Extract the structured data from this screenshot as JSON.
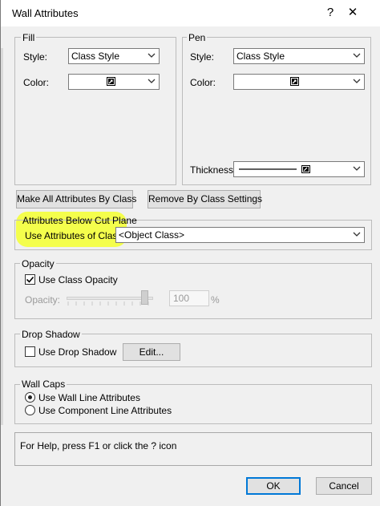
{
  "window": {
    "title": "Wall Attributes",
    "help_glyph": "?",
    "close_glyph": "✕"
  },
  "fill": {
    "group_label": "Fill",
    "style_label": "Style:",
    "style_value": "Class Style",
    "color_label": "Color:"
  },
  "pen": {
    "group_label": "Pen",
    "style_label": "Style:",
    "style_value": "Class Style",
    "color_label": "Color:",
    "thickness_label": "Thickness:"
  },
  "buttons": {
    "make_all": "Make All Attributes By Class",
    "remove_by_class": "Remove By Class Settings",
    "edit": "Edit...",
    "ok": "OK",
    "cancel": "Cancel"
  },
  "cut_plane": {
    "group_label": "Attributes Below Cut Plane",
    "use_class_label": "Use Attributes of Class:",
    "class_value": "<Object Class>"
  },
  "opacity": {
    "group_label": "Opacity",
    "use_class_opacity_label": "Use Class Opacity",
    "use_class_opacity_checked": true,
    "opacity_label": "Opacity:",
    "opacity_value": "100",
    "opacity_unit": "%",
    "slider_level_percent": 100
  },
  "drop_shadow": {
    "group_label": "Drop Shadow",
    "use_drop_shadow_label": "Use Drop Shadow",
    "use_drop_shadow_checked": false
  },
  "wall_caps": {
    "group_label": "Wall Caps",
    "option_wall_line": "Use Wall Line Attributes",
    "option_component_line": "Use Component Line Attributes",
    "selected": "wall_line"
  },
  "help_text": "For Help, press F1 or click the ? icon",
  "colors": {
    "highlight": "#f4ff3a",
    "default_button_border": "#0078d7"
  }
}
